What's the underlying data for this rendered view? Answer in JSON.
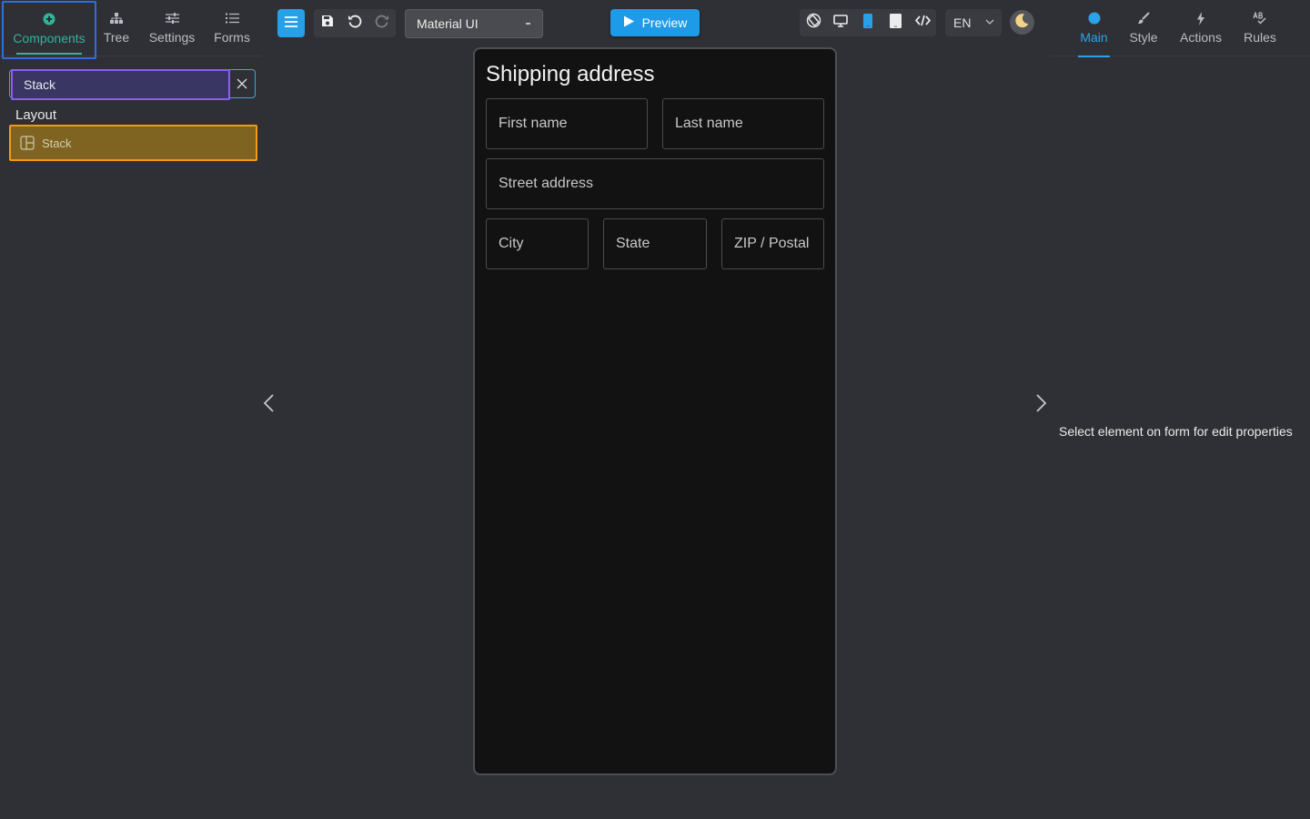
{
  "left_tabs": [
    {
      "label": "Components",
      "icon": "plus-circle-icon"
    },
    {
      "label": "Tree",
      "icon": "tree-icon"
    },
    {
      "label": "Settings",
      "icon": "sliders-icon"
    },
    {
      "label": "Forms",
      "icon": "list-icon"
    }
  ],
  "search": {
    "value": "Stack",
    "clear_icon": "close-icon"
  },
  "component_section": {
    "label": "Layout",
    "items": [
      {
        "label": "Stack",
        "icon": "layout-icon"
      }
    ]
  },
  "toolbar": {
    "theme_select": "Material UI",
    "preview_label": "Preview",
    "language": "EN"
  },
  "form": {
    "title": "Shipping address",
    "fields": {
      "first_name": "First name",
      "last_name": "Last name",
      "street": "Street address",
      "city": "City",
      "state": "State",
      "zip": "ZIP / Postal"
    }
  },
  "right_tabs": [
    {
      "label": "Main",
      "icon": "dot-icon"
    },
    {
      "label": "Style",
      "icon": "brush-icon"
    },
    {
      "label": "Actions",
      "icon": "bolt-icon"
    },
    {
      "label": "Rules",
      "icon": "spellcheck-icon"
    }
  ],
  "properties_hint": "Select element on form for edit properties",
  "colors": {
    "background": "#2f3035",
    "accent_blue": "#1e9be8",
    "accent_green": "#2fb59a",
    "highlight_orange": "#f29a16",
    "highlight_purple": "#8c5cf5"
  }
}
